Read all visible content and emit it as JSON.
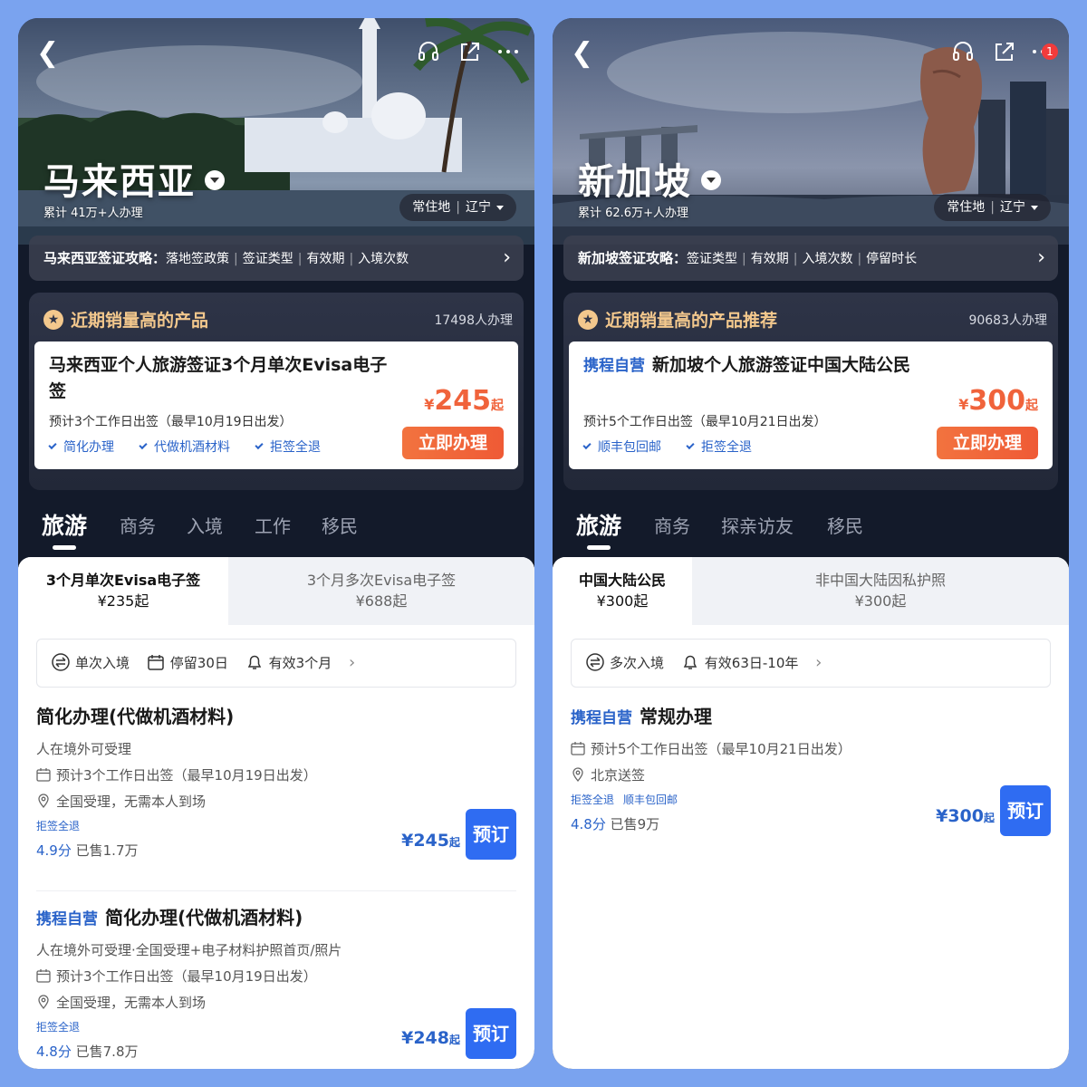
{
  "left": {
    "country": "马来西亚",
    "applied": "累计 41万+人办理",
    "residence_label": "常住地",
    "residence_value": "辽宁",
    "guide_title": "马来西亚签证攻略：",
    "guide_items": [
      "落地签政策",
      "签证类型",
      "有效期",
      "入境次数"
    ],
    "sales_heading": "近期销量高的产品",
    "sales_count": "17498人办理",
    "product": {
      "title": "马来西亚个人旅游签证3个月单次Evisa电子签",
      "estimate": "预计3个工作日出签（最早10月19日出发）",
      "tags": [
        "简化办理",
        "代做机酒材料",
        "拒签全退"
      ],
      "currency": "¥",
      "price": "245",
      "price_suffix": "起",
      "button": "立即办理"
    },
    "tabs": [
      "旅游",
      "商务",
      "入境",
      "工作",
      "移民"
    ],
    "subtabs": [
      {
        "name": "3个月单次Evisa电子签",
        "price": "¥235起"
      },
      {
        "name": "3个月多次Evisa电子签",
        "price": "¥688起"
      }
    ],
    "info": [
      "单次入境",
      "停留30日",
      "有效3个月"
    ],
    "items": [
      {
        "badge": "",
        "title": "简化办理(代做机酒材料)",
        "desc": "人在境外可受理",
        "estimate": "预计3个工作日出签（最早10月19日出发）",
        "location": "全国受理，无需本人到场",
        "tags": [
          "拒签全退"
        ],
        "score": "4.9分",
        "sold": "已售1.7万",
        "price": "¥245",
        "price_suffix": "起",
        "button": "预订"
      },
      {
        "badge": "携程自营",
        "title": "简化办理(代做机酒材料)",
        "desc": "人在境外可受理·全国受理+电子材料护照首页/照片",
        "estimate": "预计3个工作日出签（最早10月19日出发）",
        "location": "全国受理，无需本人到场",
        "tags": [
          "拒签全退"
        ],
        "score": "4.8分",
        "sold": "已售7.8万",
        "price": "¥248",
        "price_suffix": "起",
        "button": "预订"
      }
    ]
  },
  "right": {
    "country": "新加坡",
    "applied": "累计 62.6万+人办理",
    "residence_label": "常住地",
    "residence_value": "辽宁",
    "notification_count": "1",
    "guide_title": "新加坡签证攻略：",
    "guide_items": [
      "签证类型",
      "有效期",
      "入境次数",
      "停留时长"
    ],
    "sales_heading": "近期销量高的产品推荐",
    "sales_count": "90683人办理",
    "product": {
      "badge": "携程自营",
      "title": "新加坡个人旅游签证中国大陆公民",
      "estimate": "预计5个工作日出签（最早10月21日出发）",
      "tags": [
        "顺丰包回邮",
        "拒签全退"
      ],
      "currency": "¥",
      "price": "300",
      "price_suffix": "起",
      "button": "立即办理"
    },
    "tabs": [
      "旅游",
      "商务",
      "探亲访友",
      "移民"
    ],
    "subtabs": [
      {
        "name": "中国大陆公民",
        "price": "¥300起"
      },
      {
        "name": "非中国大陆因私护照",
        "price": "¥300起"
      }
    ],
    "info": [
      "多次入境",
      "有效63日-10年"
    ],
    "items": [
      {
        "badge": "携程自营",
        "title": "常规办理",
        "estimate": "预计5个工作日出签（最早10月21日出发）",
        "location": "北京送签",
        "tags": [
          "拒签全退",
          "顺丰包回邮"
        ],
        "score": "4.8分",
        "sold": "已售9万",
        "price": "¥300",
        "price_suffix": "起",
        "button": "预订"
      }
    ]
  },
  "colors": {
    "accent_blue": "#2f6cf2",
    "price_orange": "#f0633b",
    "gold": "#f3c88d",
    "page_bg": "#7aa3ef"
  },
  "icons": [
    "back-icon",
    "headset-icon",
    "share-icon",
    "more-icon",
    "star-icon",
    "check-icon",
    "calendar-icon",
    "location-icon",
    "bell-icon",
    "entry-icon"
  ]
}
